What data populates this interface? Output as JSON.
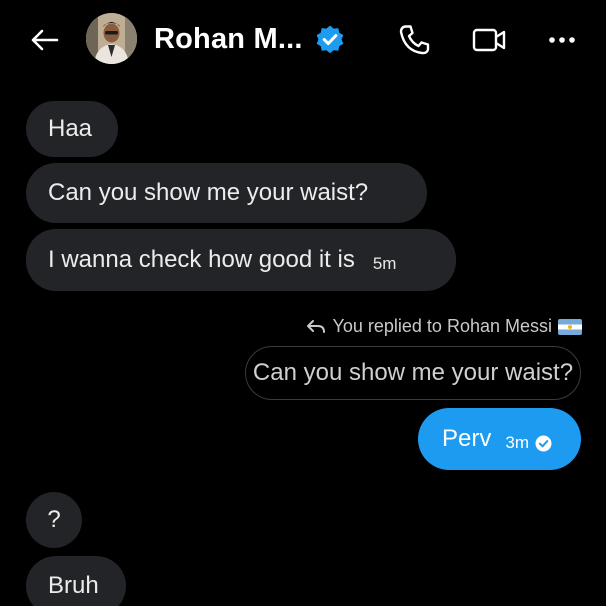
{
  "header": {
    "contact_name": "Rohan M...",
    "back_icon": "back-arrow-icon",
    "verified_icon": "verified-badge-icon",
    "call_icon": "phone-icon",
    "video_icon": "video-camera-icon",
    "more_icon": "more-dots-icon"
  },
  "messages": {
    "received": [
      {
        "text": "Haa"
      },
      {
        "text": "Can you show me your waist?"
      },
      {
        "text": "I wanna check how good it is",
        "time": "5m"
      },
      {
        "text": "?"
      },
      {
        "text": "Bruh"
      }
    ],
    "reply_note": "You replied to Rohan Messi",
    "quoted_text": "Can you show me your waist?",
    "sent": {
      "text": "Perv",
      "time": "3m"
    }
  },
  "colors": {
    "background": "#000000",
    "received_bubble": "#232428",
    "sent_bubble": "#1d9bf0",
    "verified_blue": "#1d9bf0"
  }
}
